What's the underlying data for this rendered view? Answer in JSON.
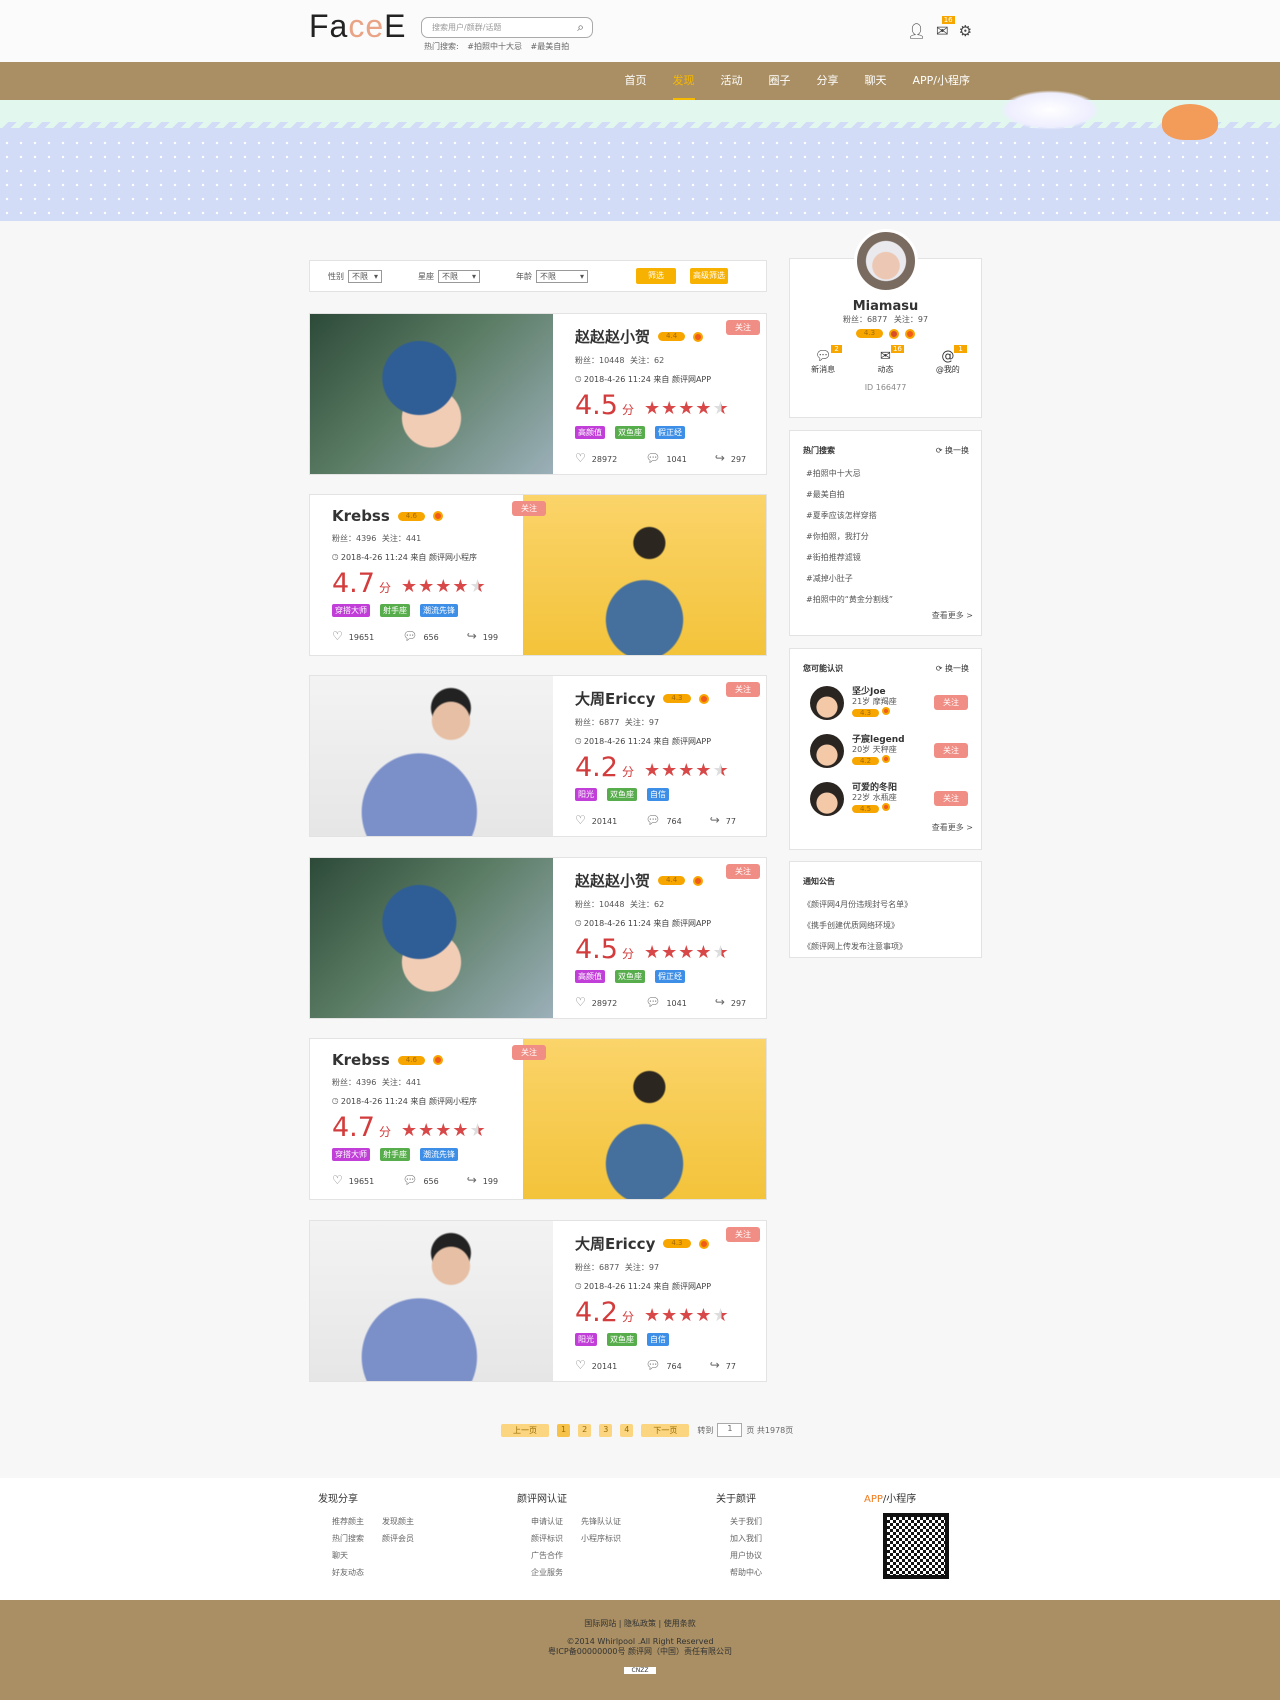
{
  "header": {
    "logo": "FaceE",
    "search_placeholder": "搜索用户/颜群/话题",
    "hot_label": "热门搜索:",
    "hot": [
      "#拍照中十大忌",
      "#最美自拍"
    ],
    "mail_badge": "16"
  },
  "nav": [
    "首页",
    "发现",
    "活动",
    "圈子",
    "分享",
    "聊天",
    "APP/小程序"
  ],
  "filter": {
    "gender_label": "性别",
    "gender": "不限",
    "star_label": "星座",
    "star": "不限",
    "age_label": "年龄",
    "age": "不限",
    "filter_btn": "筛选",
    "adv_btn": "高级筛选"
  },
  "cards": [
    {
      "name": "赵赵赵小贺",
      "badge": "4.4",
      "fans": "粉丝：10448",
      "follow": "关注：62",
      "time": "2018-4-26  11:24 来自 颜评网APP",
      "score": "4.5",
      "unit": "分",
      "tags": [
        "高颜值",
        "双鱼座",
        "假正经"
      ],
      "likes": "28972",
      "comments": "1041",
      "shares": "297",
      "follow_btn": "关注"
    },
    {
      "name": "Krebss",
      "badge": "4.6",
      "fans": "粉丝：4396",
      "follow": "关注：441",
      "time": "2018-4-26  11:24 来自 颜评网小程序",
      "score": "4.7",
      "unit": "分",
      "tags": [
        "穿搭大师",
        "射手座",
        "潮流先锋"
      ],
      "likes": "19651",
      "comments": "656",
      "shares": "199",
      "follow_btn": "关注"
    },
    {
      "name": "大周Ericcy",
      "badge": "4.3",
      "fans": "粉丝：6877",
      "follow": "关注：97",
      "time": "2018-4-26  11:24 来自 颜评网APP",
      "score": "4.2",
      "unit": "分",
      "tags": [
        "阳光",
        "双鱼座",
        "自信"
      ],
      "likes": "20141",
      "comments": "764",
      "shares": "77",
      "follow_btn": "关注"
    }
  ],
  "tag_colors": [
    "#c13fd8",
    "#57ad4b",
    "#3d8ee6"
  ],
  "profile": {
    "name": "Miamasu",
    "fans": "粉丝：6877",
    "follow": "关注：97",
    "score": "4.3",
    "msg_label": "新消息",
    "msg_count": "2",
    "dyn_label": "动态",
    "dyn_count": "16",
    "at_label": "@我的",
    "at_count": "1",
    "id": "ID 166477"
  },
  "hot_search": {
    "title": "热门搜索",
    "refresh": "换一换",
    "items": [
      "#拍照中十大忌",
      "#最美自拍",
      "#夏季应该怎样穿搭",
      "#你拍照，我打分",
      "#街拍推荐滤镜",
      "#减掉小肚子",
      "#拍照中的“黄金分割线”"
    ],
    "more": "查看更多 >"
  },
  "may_know": {
    "title": "您可能认识",
    "refresh": "换一换",
    "people": [
      {
        "name": "坚少Joe",
        "age": "21岁",
        "star": "摩羯座",
        "score": "4.3"
      },
      {
        "name": "子宸legend",
        "age": "20岁",
        "star": "天秤座",
        "score": "4.2"
      },
      {
        "name": "可爱的冬阳",
        "age": "22岁",
        "star": "水瓶座",
        "score": "4.5"
      }
    ],
    "follow_btn": "关注",
    "more": "查看更多 >"
  },
  "notice": {
    "title": "通知公告",
    "items": [
      "《颜评网4月份违规封号名单》",
      "《携手创建优质网络环境》",
      "《颜评网上传发布注意事项》"
    ]
  },
  "pager": {
    "prev": "上一页",
    "pages": [
      "1",
      "2",
      "3",
      "4"
    ],
    "next": "下一页",
    "goto": "转到",
    "value": "1",
    "total": "页 共1978页"
  },
  "footer": {
    "cols": [
      {
        "title": "发现分享",
        "links": [
          "推荐颜主",
          "发现颜主",
          "热门搜索",
          "颜评会员",
          "聊天",
          "",
          "好友动态",
          ""
        ]
      },
      {
        "title": "颜评网认证",
        "links": [
          "申请认证",
          "先锋队认证",
          "颜评标识",
          "小程序标识",
          "广告合作",
          "",
          "企业服务",
          ""
        ]
      },
      {
        "title": "关于颜评",
        "links": [
          "关于我们",
          "加入我们",
          "用户协议",
          "帮助中心"
        ]
      }
    ],
    "app_a": "APP",
    "app_b": "/小程序",
    "links": "国际网站 | 隐私政策 | 使用条款",
    "copyright": "©2014 Whirlpool .All Right Reserved",
    "icp": "粤ICP备00000000号 颜评网（中国）责任有限公司",
    "cnzz": "CNZZ"
  }
}
